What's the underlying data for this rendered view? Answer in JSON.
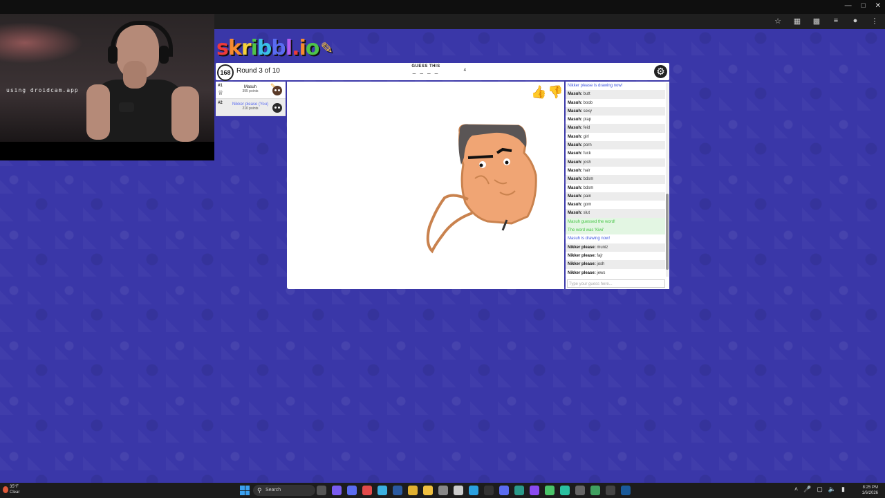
{
  "webcam": {
    "overlay_text": "using droidcam.app"
  },
  "game": {
    "logo_text": "skribbl.io",
    "timer": "168",
    "round": "Round 3 of 10",
    "guess_label": "GUESS THIS",
    "word_blanks": "_ _ _ _",
    "word_length": "4"
  },
  "players": [
    {
      "rank": "#1",
      "name": "Masuh",
      "points": "395 points"
    },
    {
      "rank": "#2",
      "name": "Nikker please (You)",
      "points": "210 points"
    }
  ],
  "chat": {
    "messages": [
      {
        "type": "system-blue",
        "text": "Nikker please is drawing now!"
      },
      {
        "who": "Masuh:",
        "text": "butt"
      },
      {
        "who": "Masuh:",
        "text": "boob"
      },
      {
        "who": "Masuh:",
        "text": "sexy"
      },
      {
        "who": "Masuh:",
        "text": "plap"
      },
      {
        "who": "Masuh:",
        "text": "feid"
      },
      {
        "who": "Masuh:",
        "text": "girl"
      },
      {
        "who": "Masuh:",
        "text": "porn"
      },
      {
        "who": "Masuh:",
        "text": "fuck"
      },
      {
        "who": "Masuh:",
        "text": "josh"
      },
      {
        "who": "Masuh:",
        "text": "hair"
      },
      {
        "who": "Masuh:",
        "text": "bdsm"
      },
      {
        "who": "Masuh:",
        "text": "bdsm"
      },
      {
        "who": "Masuh:",
        "text": "pain"
      },
      {
        "who": "Masuh:",
        "text": "gom"
      },
      {
        "who": "Masuh:",
        "text": "slut"
      },
      {
        "type": "system-green",
        "text": "Masuh guessed the word!"
      },
      {
        "type": "system-green",
        "text": "The word was 'Kiwi'"
      },
      {
        "type": "system-blue",
        "text": "Masuh is drawing now!"
      },
      {
        "who": "Nikker please:",
        "text": "muniz"
      },
      {
        "who": "Nikker please:",
        "text": "fajr"
      },
      {
        "who": "Nikker please:",
        "text": "josh"
      },
      {
        "who": "Nikker please:",
        "text": "jews"
      }
    ],
    "input_placeholder": "Type your guess here..."
  },
  "taskbar": {
    "weather_temp": "35°F",
    "weather_desc": "Clear",
    "search_placeholder": "Search",
    "time": "8:25 PM",
    "date": "1/6/2026"
  },
  "colors": {
    "background": "#3a37a8",
    "logo": [
      "#ee3a3a",
      "#f78b2f",
      "#f5d13a",
      "#4ec44a",
      "#3ac0e8",
      "#5a6cf0",
      "#b35cf0",
      "#ee3a3a",
      "#f78b2f",
      "#4ec44a"
    ]
  }
}
